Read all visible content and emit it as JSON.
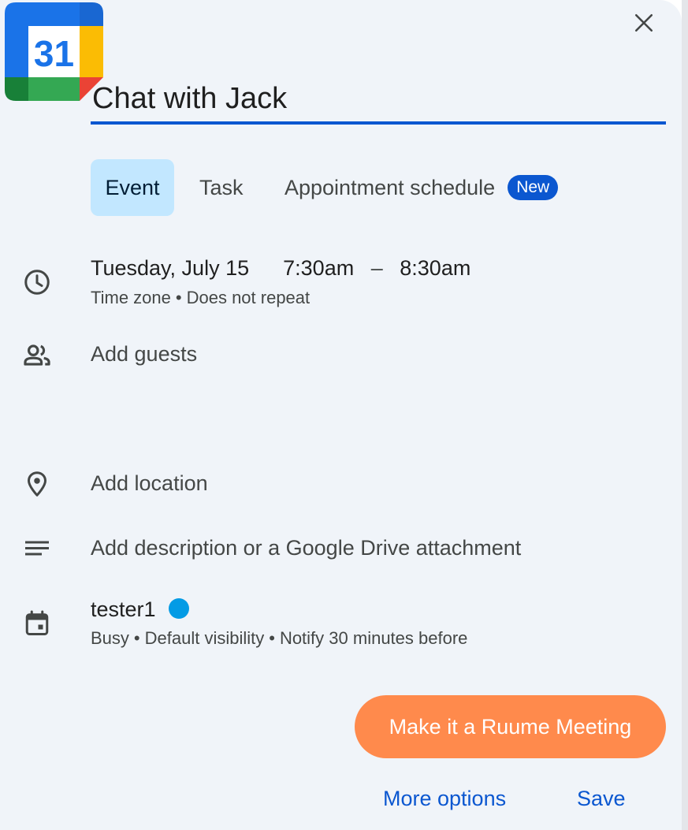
{
  "app": {
    "icon_label": "31"
  },
  "dialog": {
    "title_value": "Chat with Jack",
    "tabs": [
      {
        "label": "Event",
        "active": true
      },
      {
        "label": "Task",
        "active": false
      },
      {
        "label": "Appointment schedule",
        "active": false,
        "badge": "New"
      }
    ],
    "datetime": {
      "date": "Tuesday, July 15",
      "start": "7:30am",
      "separator": "–",
      "end": "8:30am",
      "timezone": "Time zone",
      "repeat": "Does not repeat"
    },
    "guests_placeholder": "Add guests",
    "location_placeholder": "Add location",
    "description_placeholder": "Add description or a Google Drive attachment",
    "calendar": {
      "name": "tester1",
      "color": "#039be5",
      "status": "Busy",
      "visibility": "Default visibility",
      "notification": "Notify 30 minutes before"
    },
    "ruume_button": "Make it a Ruume Meeting",
    "more_options": "More options",
    "save": "Save"
  },
  "colors": {
    "accent": "#0b57d0",
    "active_tab_bg": "#c2e7ff",
    "ruume_orange": "#ff8a4c",
    "dialog_bg": "#f0f4f9"
  },
  "icons": [
    "google-calendar-icon",
    "close-icon",
    "clock-icon",
    "people-icon",
    "location-pin-icon",
    "notes-icon",
    "calendar-event-icon"
  ]
}
